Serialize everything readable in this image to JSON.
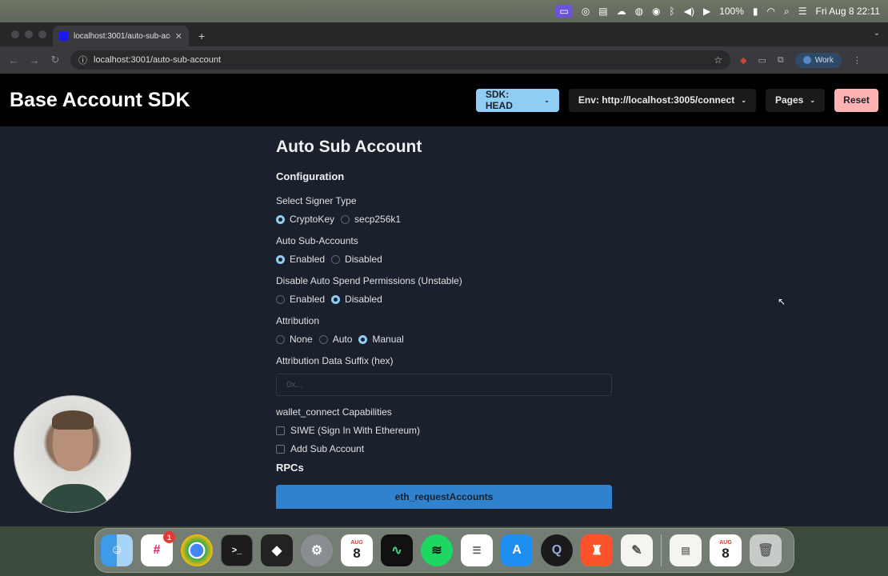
{
  "menubar": {
    "battery": "100%",
    "datetime": "Fri Aug 8  22:11"
  },
  "browser": {
    "tab_title": "localhost:3001/auto-sub-acc",
    "url": "localhost:3001/auto-sub-account",
    "profile_label": "Work"
  },
  "header": {
    "brand": "Base Account SDK",
    "sdk_button": "SDK: HEAD",
    "env_button": "Env: http://localhost:3005/connect",
    "pages_button": "Pages",
    "reset_button": "Reset"
  },
  "main": {
    "title": "Auto Sub Account",
    "configuration_heading": "Configuration",
    "signer": {
      "label": "Select Signer Type",
      "options": [
        "CryptoKey",
        "secp256k1"
      ],
      "selected": "CryptoKey"
    },
    "auto_sub_accounts": {
      "label": "Auto Sub-Accounts",
      "options": [
        "Enabled",
        "Disabled"
      ],
      "selected": "Enabled"
    },
    "disable_spend": {
      "label": "Disable Auto Spend Permissions (Unstable)",
      "options": [
        "Enabled",
        "Disabled"
      ],
      "selected": "Disabled"
    },
    "attribution": {
      "label": "Attribution",
      "options": [
        "None",
        "Auto",
        "Manual"
      ],
      "selected": "Manual"
    },
    "suffix": {
      "label": "Attribution Data Suffix (hex)",
      "placeholder": "0x..."
    },
    "capabilities": {
      "label": "wallet_connect Capabilities",
      "options": [
        "SIWE (Sign In With Ethereum)",
        "Add Sub Account"
      ]
    },
    "rpcs_heading": "RPCs",
    "rpc_button": "eth_requestAccounts"
  },
  "dock": {
    "calendar_month": "AUG",
    "calendar_day": "8",
    "slack_badge": "1"
  }
}
